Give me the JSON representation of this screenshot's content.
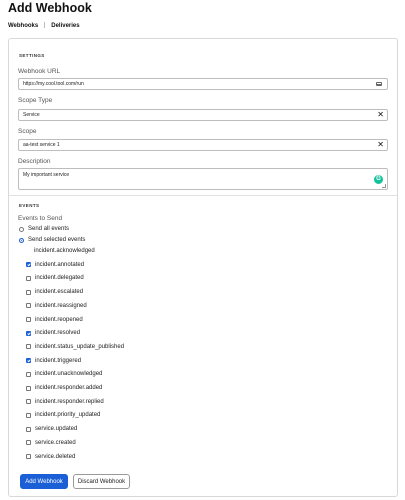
{
  "page": {
    "title": "Add Webhook"
  },
  "tabs": [
    {
      "label": "Webhooks"
    },
    {
      "label": "Deliveries"
    }
  ],
  "settings": {
    "heading": "SETTINGS",
    "webhook_url": {
      "label": "Webhook URL",
      "value": "https://my.cool.tool.com/run"
    },
    "scope_type": {
      "label": "Scope Type",
      "value": "Service"
    },
    "scope": {
      "label": "Scope",
      "value": "aa-test service 1"
    },
    "description": {
      "label": "Description",
      "value": "My important service"
    }
  },
  "events": {
    "heading": "EVENTS",
    "label": "Events to Send",
    "options": [
      {
        "label": "Send all events",
        "selected": false
      },
      {
        "label": "Send selected events",
        "selected": true
      }
    ],
    "items": [
      {
        "label": "incident.acknowledged",
        "checked": false,
        "show_box": false
      },
      {
        "label": "incident.annotated",
        "checked": true,
        "show_box": true
      },
      {
        "label": "incident.delegated",
        "checked": false,
        "show_box": true
      },
      {
        "label": "incident.escalated",
        "checked": false,
        "show_box": true
      },
      {
        "label": "incident.reassigned",
        "checked": false,
        "show_box": true
      },
      {
        "label": "incident.reopened",
        "checked": false,
        "show_box": true
      },
      {
        "label": "incident.resolved",
        "checked": true,
        "show_box": true
      },
      {
        "label": "incident.status_update_published",
        "checked": false,
        "show_box": true
      },
      {
        "label": "incident.triggered",
        "checked": true,
        "show_box": true
      },
      {
        "label": "incident.unacknowledged",
        "checked": false,
        "show_box": true
      },
      {
        "label": "incident.responder.added",
        "checked": false,
        "show_box": true
      },
      {
        "label": "incident.responder.replied",
        "checked": false,
        "show_box": true
      },
      {
        "label": "incident.priority_updated",
        "checked": false,
        "show_box": true
      },
      {
        "label": "service.updated",
        "checked": false,
        "show_box": true
      },
      {
        "label": "service.created",
        "checked": false,
        "show_box": true
      },
      {
        "label": "service.deleted",
        "checked": false,
        "show_box": true
      }
    ]
  },
  "actions": {
    "add_label": "Add Webhook",
    "discard_label": "Discard Webhook"
  },
  "colors": {
    "primary": "#1b5fd6",
    "grammarly": "#15c39a"
  }
}
